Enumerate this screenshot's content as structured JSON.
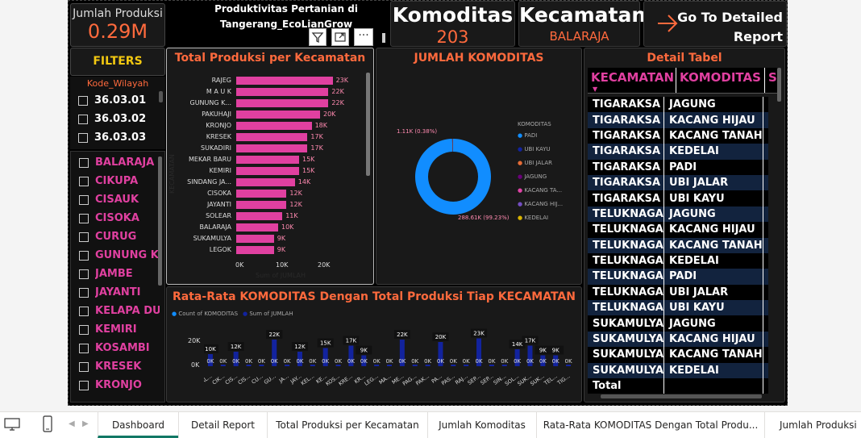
{
  "kpi_produksi": {
    "label": "Jumlah Produksi",
    "value": "0.29M"
  },
  "title": {
    "line1": "Produktivitas Pertanian di",
    "line2": "Tangerang_EcoLianGrow"
  },
  "kpi_komoditas": {
    "label": "Komoditas",
    "value": "203"
  },
  "kpi_kecamatan": {
    "label": "Kecamatan",
    "value": "BALARAJA"
  },
  "detail_button": {
    "line1": "Go To Detailed",
    "line2": "Report"
  },
  "filters": {
    "title": "FILTERS",
    "wilayah_label": "Kode_Wilayah",
    "wilayah": [
      "36.03.01",
      "36.03.02",
      "36.03.03"
    ],
    "kecamatan": [
      "BALARAJA",
      "CIKUPA",
      "CISAUK",
      "CISOKA",
      "CURUG",
      "GUNUNG K...",
      "JAMBE",
      "JAYANTI",
      "KELAPA DUA",
      "KEMIRI",
      "KOSAMBI",
      "KRESEK",
      "KRONJO"
    ]
  },
  "bar_chart": {
    "title": "Total Produksi per Kecamatan",
    "axis_ticks": [
      "0K",
      "10K",
      "20K"
    ],
    "ylabel": "KECAMATAN",
    "xlabel": "Sum of JUMLAH"
  },
  "donut": {
    "title": "JUMLAH KOMODITAS",
    "label_small": "1.11K (0.38%)",
    "label_big": "288.61K (99.23%)",
    "legend_title": "KOMODITAS",
    "legend": [
      {
        "name": "PADI",
        "color": "#118dff"
      },
      {
        "name": "UBI KAYU",
        "color": "#12239e"
      },
      {
        "name": "UBI JALAR",
        "color": "#e66c37"
      },
      {
        "name": "JAGUNG",
        "color": "#6b007b"
      },
      {
        "name": "KACANG TA...",
        "color": "#e044a7"
      },
      {
        "name": "KACANG HIJ...",
        "color": "#744ec2"
      },
      {
        "name": "KEDELAI",
        "color": "#d9b300"
      }
    ]
  },
  "combo": {
    "title": "Rata-Rata KOMODITAS Dengan Total Produksi Tiap KECAMATAN",
    "legend": [
      "Count of KOMODITAS",
      "Sum of JUMLAH"
    ],
    "y_ticks": [
      "20K",
      "0K"
    ],
    "categories": [
      "BAL...",
      "CIK...",
      "CIS...",
      "CIS...",
      "CU...",
      "GU...",
      "JA...",
      "JAY...",
      "KEL...",
      "KE...",
      "KOS...",
      "KRE...",
      "KR...",
      "LEG...",
      "MA...",
      "ME...",
      "PAG...",
      "PAK...",
      "PA...",
      "PAS...",
      "RAJ...",
      "SEP...",
      "SEP...",
      "SIN...",
      "SOL...",
      "SUK...",
      "SUK...",
      "TEL...",
      "TIG..."
    ],
    "count_labels": [
      "0K",
      "0K",
      "0K",
      "0K",
      "0K",
      "0K",
      "0K",
      "0K",
      "0K",
      "0K",
      "0K",
      "0K",
      "0K",
      "0K",
      "0K",
      "0K",
      "0K",
      "0K",
      "0K",
      "0K",
      "0K",
      "0K",
      "0K",
      "0K",
      "0K",
      "0K",
      "0K",
      "0K",
      "0K"
    ]
  },
  "chart_data": [
    {
      "type": "bar",
      "title": "Total Produksi per Kecamatan",
      "orientation": "horizontal",
      "categories": [
        "RAJEG",
        "M A U K",
        "GUNUNG K...",
        "PAKUHAJI",
        "KRONJO",
        "KRESEK",
        "SUKADIRI",
        "MEKAR BARU",
        "KEMIRI",
        "SINDANG JA...",
        "CISOKA",
        "JAYANTI",
        "SOLEAR",
        "BALARAJA",
        "SUKAMULYA",
        "LEGOK"
      ],
      "values": [
        23,
        22,
        22,
        20,
        18,
        17,
        17,
        15,
        15,
        14,
        12,
        12,
        11,
        10,
        9,
        9
      ],
      "value_labels": [
        "23K",
        "22K",
        "22K",
        "20K",
        "18K",
        "17K",
        "17K",
        "15K",
        "15K",
        "14K",
        "12K",
        "12K",
        "11K",
        "10K",
        "9K",
        "9K"
      ],
      "unit": "K",
      "xlim": [
        0,
        25
      ]
    },
    {
      "type": "pie",
      "title": "JUMLAH KOMODITAS",
      "categories": [
        "PADI",
        "UBI KAYU",
        "UBI JALAR",
        "JAGUNG",
        "KACANG TA...",
        "KACANG HIJ...",
        "KEDELAI"
      ],
      "values": [
        288.61,
        0.3,
        0.2,
        0.2,
        0.15,
        0.13,
        0.13
      ]
    },
    {
      "type": "bar",
      "title": "Rata-Rata KOMODITAS Dengan Total Produksi Tiap KECAMATAN",
      "categories": [
        "BAL...",
        "CIK...",
        "CIS...",
        "CIS...",
        "CU...",
        "GU...",
        "JA...",
        "JAY...",
        "KEL...",
        "KE...",
        "KOS...",
        "KRE...",
        "KR...",
        "LEG...",
        "MA...",
        "ME...",
        "PAG...",
        "PAK...",
        "PA...",
        "PAS...",
        "RAJ...",
        "SEP...",
        "SEP...",
        "SIN...",
        "SOL...",
        "SUK...",
        "SUK...",
        "TEL...",
        "TIG..."
      ],
      "series": [
        {
          "name": "Count of KOMODITAS",
          "values": [
            0,
            0,
            0,
            0,
            0,
            0,
            0,
            0,
            0,
            0,
            0,
            0,
            0,
            0,
            0,
            0,
            0,
            0,
            0,
            0,
            0,
            0,
            0,
            0,
            0,
            0,
            0,
            0,
            0
          ]
        },
        {
          "name": "Sum of JUMLAH",
          "values": [
            10,
            0,
            12,
            0,
            0,
            22,
            0,
            12,
            0,
            15,
            0,
            17,
            9,
            0,
            0,
            22,
            0,
            0,
            20,
            0,
            0,
            23,
            0,
            0,
            14,
            17,
            9,
            9,
            0
          ]
        }
      ],
      "labels_shown": [
        "10K",
        "12K",
        "22K",
        "12K",
        "15K",
        "17K",
        "9K",
        "22K",
        "20K",
        "23K",
        "14K",
        "17K",
        "9K",
        "9K"
      ]
    }
  ],
  "detail_table": {
    "title": "Detail Tabel",
    "headers": [
      "KECAMATAN",
      "KOMODITAS",
      "S"
    ],
    "rows": [
      [
        "TIGARAKSA",
        "JAGUNG"
      ],
      [
        "TIGARAKSA",
        "KACANG HIJAU"
      ],
      [
        "TIGARAKSA",
        "KACANG TANAH"
      ],
      [
        "TIGARAKSA",
        "KEDELAI"
      ],
      [
        "TIGARAKSA",
        "PADI"
      ],
      [
        "TIGARAKSA",
        "UBI JALAR"
      ],
      [
        "TIGARAKSA",
        "UBI KAYU"
      ],
      [
        "TELUKNAGA",
        "JAGUNG"
      ],
      [
        "TELUKNAGA",
        "KACANG HIJAU"
      ],
      [
        "TELUKNAGA",
        "KACANG TANAH"
      ],
      [
        "TELUKNAGA",
        "KEDELAI"
      ],
      [
        "TELUKNAGA",
        "PADI"
      ],
      [
        "TELUKNAGA",
        "UBI JALAR"
      ],
      [
        "TELUKNAGA",
        "UBI KAYU"
      ],
      [
        "SUKAMULYA",
        "JAGUNG"
      ],
      [
        "SUKAMULYA",
        "KACANG HIJAU"
      ],
      [
        "SUKAMULYA",
        "KACANG TANAH"
      ],
      [
        "SUKAMULYA",
        "KEDELAI"
      ],
      [
        "Total",
        ""
      ]
    ]
  },
  "tabs": [
    "Dashboard",
    "Detail Report",
    "Total Produksi per Kecamatan",
    "Jumlah Komoditas",
    "Rata-Rata KOMODITAS Dengan Total Produ...",
    "Jumlah Produksi"
  ]
}
